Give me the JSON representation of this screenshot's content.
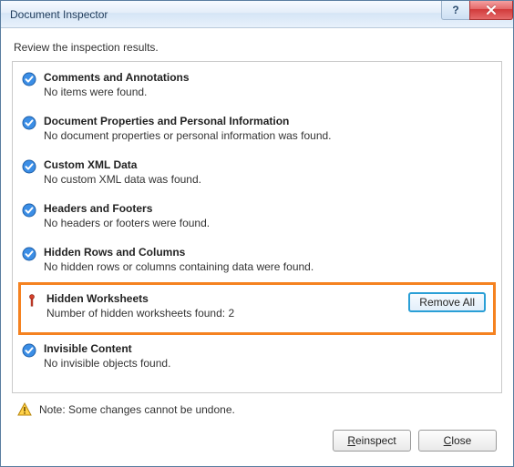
{
  "window": {
    "title": "Document Inspector"
  },
  "instruction": "Review the inspection results.",
  "items": [
    {
      "status": "ok",
      "heading": "Comments and Annotations",
      "detail": "No items were found."
    },
    {
      "status": "ok",
      "heading": "Document Properties and Personal Information",
      "detail": "No document properties or personal information was found."
    },
    {
      "status": "ok",
      "heading": "Custom XML Data",
      "detail": "No custom XML data was found."
    },
    {
      "status": "ok",
      "heading": "Headers and Footers",
      "detail": "No headers or footers were found."
    },
    {
      "status": "ok",
      "heading": "Hidden Rows and Columns",
      "detail": "No hidden rows or columns containing data were found."
    },
    {
      "status": "warn",
      "heading": "Hidden Worksheets",
      "detail": "Number of hidden worksheets found: 2",
      "action": "Remove All",
      "highlighted": true
    },
    {
      "status": "ok",
      "heading": "Invisible Content",
      "detail": "No invisible objects found."
    }
  ],
  "note": "Note: Some changes cannot be undone.",
  "buttons": {
    "reinspect": "Reinspect",
    "close": "Close"
  }
}
